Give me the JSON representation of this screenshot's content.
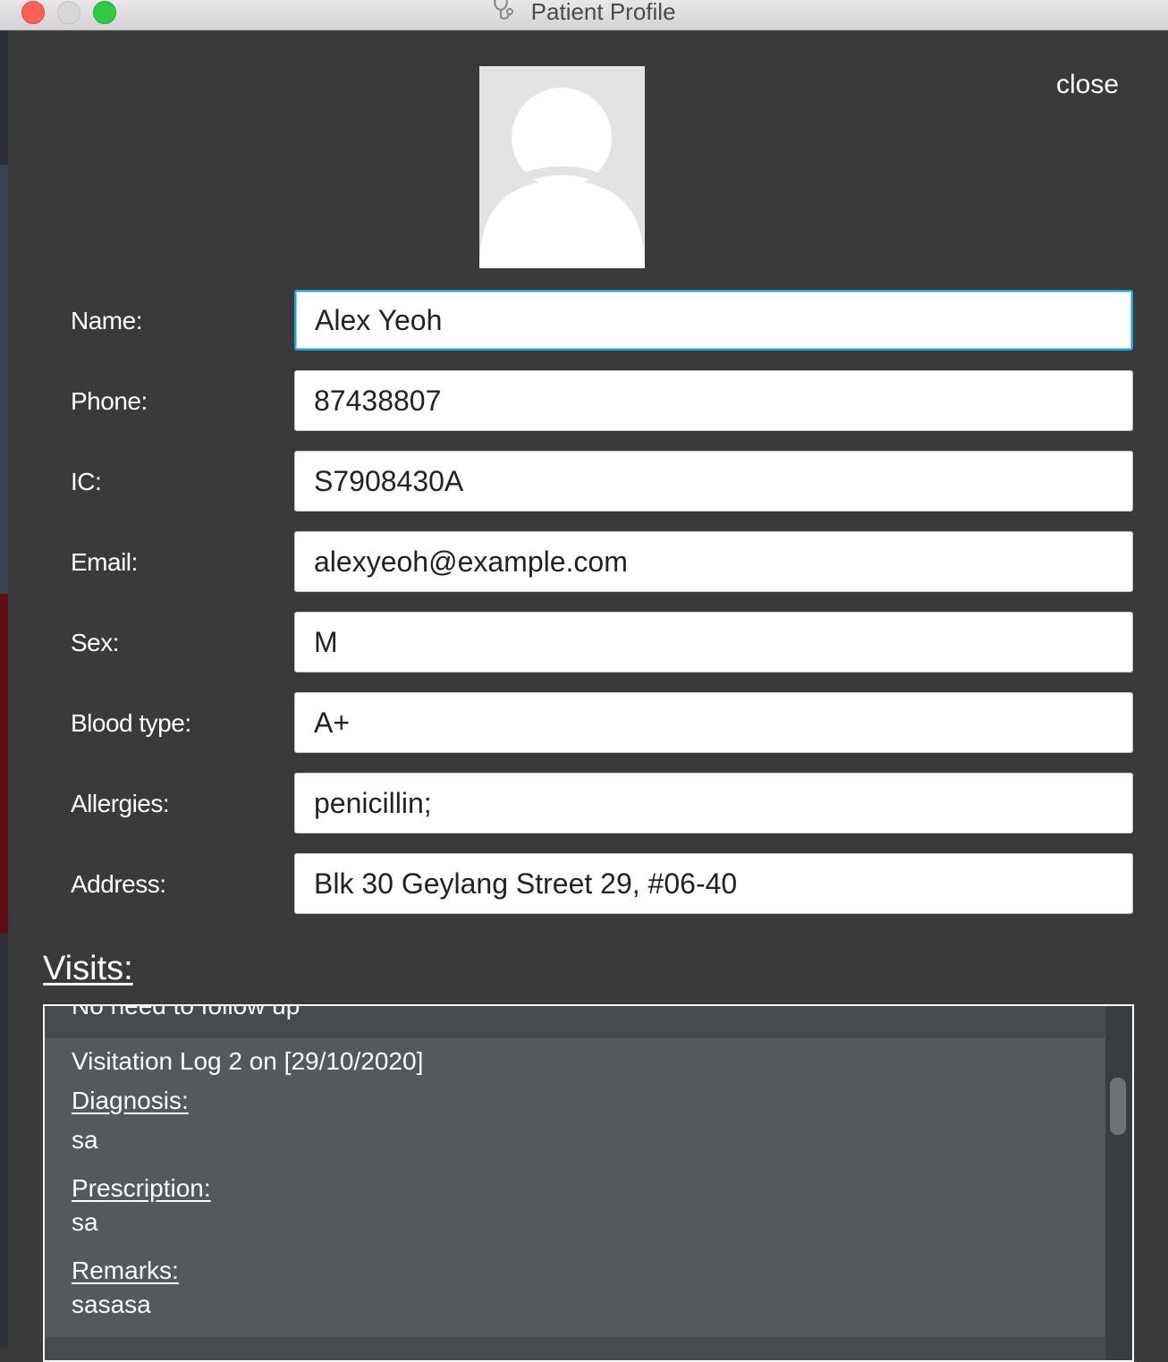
{
  "window": {
    "title": "Patient Profile",
    "icon": "stethoscope-icon"
  },
  "header": {
    "avatar": "default-avatar-placeholder",
    "close_label": "close"
  },
  "fields": [
    {
      "label": "Name:",
      "value": "Alex Yeoh"
    },
    {
      "label": "Phone:",
      "value": "87438807"
    },
    {
      "label": "IC:",
      "value": "S7908430A"
    },
    {
      "label": "Email:",
      "value": "alexyeoh@example.com"
    },
    {
      "label": "Sex:",
      "value": "M"
    },
    {
      "label": "Blood type:",
      "value": "A+"
    },
    {
      "label": "Allergies:",
      "value": "penicillin;"
    },
    {
      "label": "Address:",
      "value": "Blk 30 Geylang Street 29, #06-40"
    }
  ],
  "visits": {
    "heading": "Visits:",
    "previous_entry_tail": "No need to follow up",
    "entry": {
      "title": "Visitation Log 2 on [29/10/2020]",
      "diagnosis_label": "Diagnosis:",
      "diagnosis": "sa",
      "prescription_label": "Prescription:",
      "prescription": "sa",
      "remarks_label": "Remarks:",
      "remarks": "sasasa"
    }
  },
  "colors": {
    "window_bg": "#3a3a3a",
    "focus_ring": "#1aa4e0",
    "visit_card_bg": "#53595c"
  }
}
